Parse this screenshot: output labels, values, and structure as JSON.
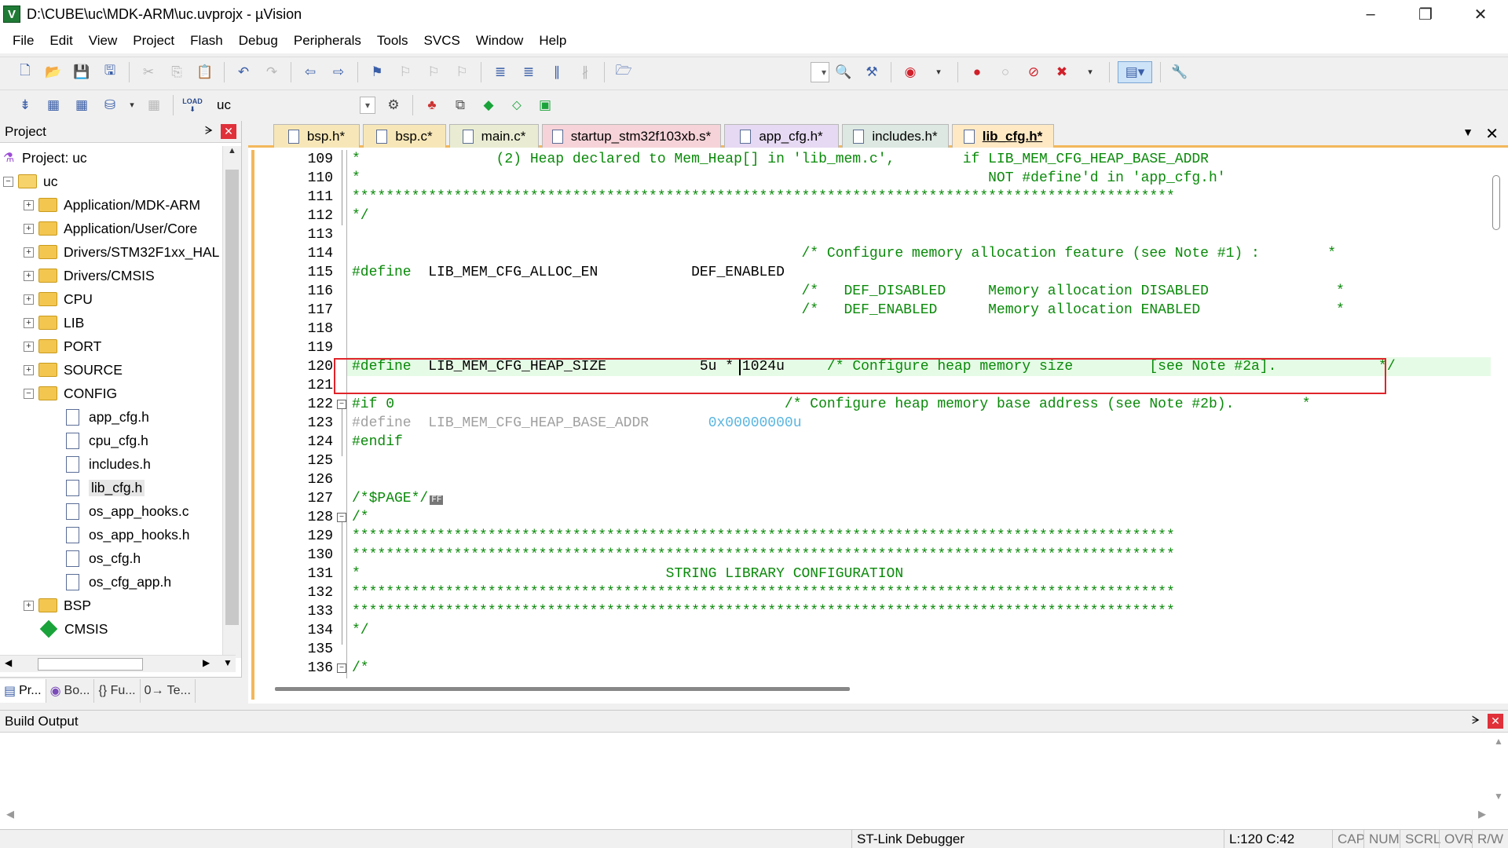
{
  "window": {
    "title": "D:\\CUBE\\uc\\MDK-ARM\\uc.uvprojx - µVision",
    "app_icon": "V",
    "controls": {
      "minimize": "–",
      "maximize": "❐",
      "close": "✕"
    }
  },
  "menu": [
    "File",
    "Edit",
    "View",
    "Project",
    "Flash",
    "Debug",
    "Peripherals",
    "Tools",
    "SVCS",
    "Window",
    "Help"
  ],
  "toolbar2": {
    "target": "uc",
    "load_label": "LOAD"
  },
  "project_panel": {
    "title": "Project",
    "pin": "ᗒ",
    "close": "✕",
    "root": "Project: uc",
    "target": "uc",
    "groups": [
      {
        "label": "Application/MDK-ARM"
      },
      {
        "label": "Application/User/Core"
      },
      {
        "label": "Drivers/STM32F1xx_HAL"
      },
      {
        "label": "Drivers/CMSIS"
      },
      {
        "label": "CPU"
      },
      {
        "label": "LIB"
      },
      {
        "label": "PORT"
      },
      {
        "label": "SOURCE"
      },
      {
        "label": "CONFIG"
      }
    ],
    "config_files": [
      "app_cfg.h",
      "cpu_cfg.h",
      "includes.h",
      "lib_cfg.h",
      "os_app_hooks.c",
      "os_app_hooks.h",
      "os_cfg.h",
      "os_cfg_app.h"
    ],
    "selected_file": "lib_cfg.h",
    "after_groups": [
      "BSP"
    ],
    "cmsis": "CMSIS",
    "bottom_tabs": [
      "Pr...",
      "Bo...",
      "{} Fu...",
      "0→ Te..."
    ]
  },
  "editor": {
    "tabs": [
      {
        "label": "bsp.h*",
        "color": "#f7e7b8"
      },
      {
        "label": "bsp.c*",
        "color": "#f7e7b8"
      },
      {
        "label": "main.c*",
        "color": "#e9ecd2"
      },
      {
        "label": "startup_stm32f103xb.s*",
        "color": "#f6d3d8"
      },
      {
        "label": "app_cfg.h*",
        "color": "#e6d9f3"
      },
      {
        "label": "includes.h*",
        "color": "#dce8e1"
      },
      {
        "label": "lib_cfg.h*",
        "color": "#ffe9c4"
      }
    ],
    "active_tab": "lib_cfg.h*",
    "line_numbers": [
      "109",
      "110",
      "111",
      "112",
      "113",
      "114",
      "115",
      "116",
      "117",
      "118",
      "119",
      "120",
      "121",
      "122",
      "123",
      "124",
      "125",
      "126",
      "127",
      "128",
      "129",
      "130",
      "131",
      "132",
      "133",
      "134",
      "135",
      "136"
    ],
    "lines": {
      "l109": "*                (2) Heap declared to Mem_Heap[] in 'lib_mem.c',        if LIB_MEM_CFG_HEAP_BASE_ADDR",
      "l110": "*                                                                          NOT #define'd in 'app_cfg.h'",
      "l111": "*************************************************************************************************",
      "l112": "*/",
      "l113": "",
      "l114": "                                                     /* Configure memory allocation feature (see Note #1) :        *",
      "l115a": "#define",
      "l115b": "  LIB_MEM_CFG_ALLOC_EN           DEF_ENABLED",
      "l116": "                                                     /*   DEF_DISABLED     Memory allocation DISABLED               *",
      "l117": "                                                     /*   DEF_ENABLED      Memory allocation ENABLED                *",
      "l118": "",
      "l119": "",
      "l120a": "#define",
      "l120b": "  LIB_MEM_CFG_HEAP_SIZE           5u * 1024u",
      "l120c": "     /* Configure heap memory size         [see Note #2a].            */",
      "l121": "",
      "l122a": "#if 0",
      "l122b": "                                              /* Configure heap memory base address (see Note #2b).        *",
      "l123a": "#define  LIB_MEM_CFG_HEAP_BASE_ADDR       ",
      "l123b": "0x00000000u",
      "l124": "#endif",
      "l125": "",
      "l126": "",
      "l127": "/*$PAGE*/",
      "l127_ff": "FF",
      "l128": "/*",
      "l129": "*************************************************************************************************",
      "l130": "*************************************************************************************************",
      "l131": "*                                    STRING LIBRARY CONFIGURATION",
      "l132": "*************************************************************************************************",
      "l133": "*************************************************************************************************",
      "l134": "*/",
      "l135": "",
      "l136": "/*"
    },
    "cursor": {
      "line": 120,
      "col": 42
    },
    "tab_dropdown": "▼",
    "tab_close": "✕"
  },
  "build_output": {
    "title": "Build Output",
    "pin": "ᗒ",
    "close": "✕"
  },
  "statusbar": {
    "debugger": "ST-Link Debugger",
    "position": "L:120 C:42",
    "cap": "CAP",
    "num": "NUM",
    "scrl": "SCRL",
    "ovr": "OVR",
    "rw": "R/W"
  },
  "colors": {
    "accent_tab_border": "#f3b75a",
    "highlight_box": "#e0242a",
    "comment": "#0a8a0a",
    "inactive_code": "#a0a0a0"
  }
}
